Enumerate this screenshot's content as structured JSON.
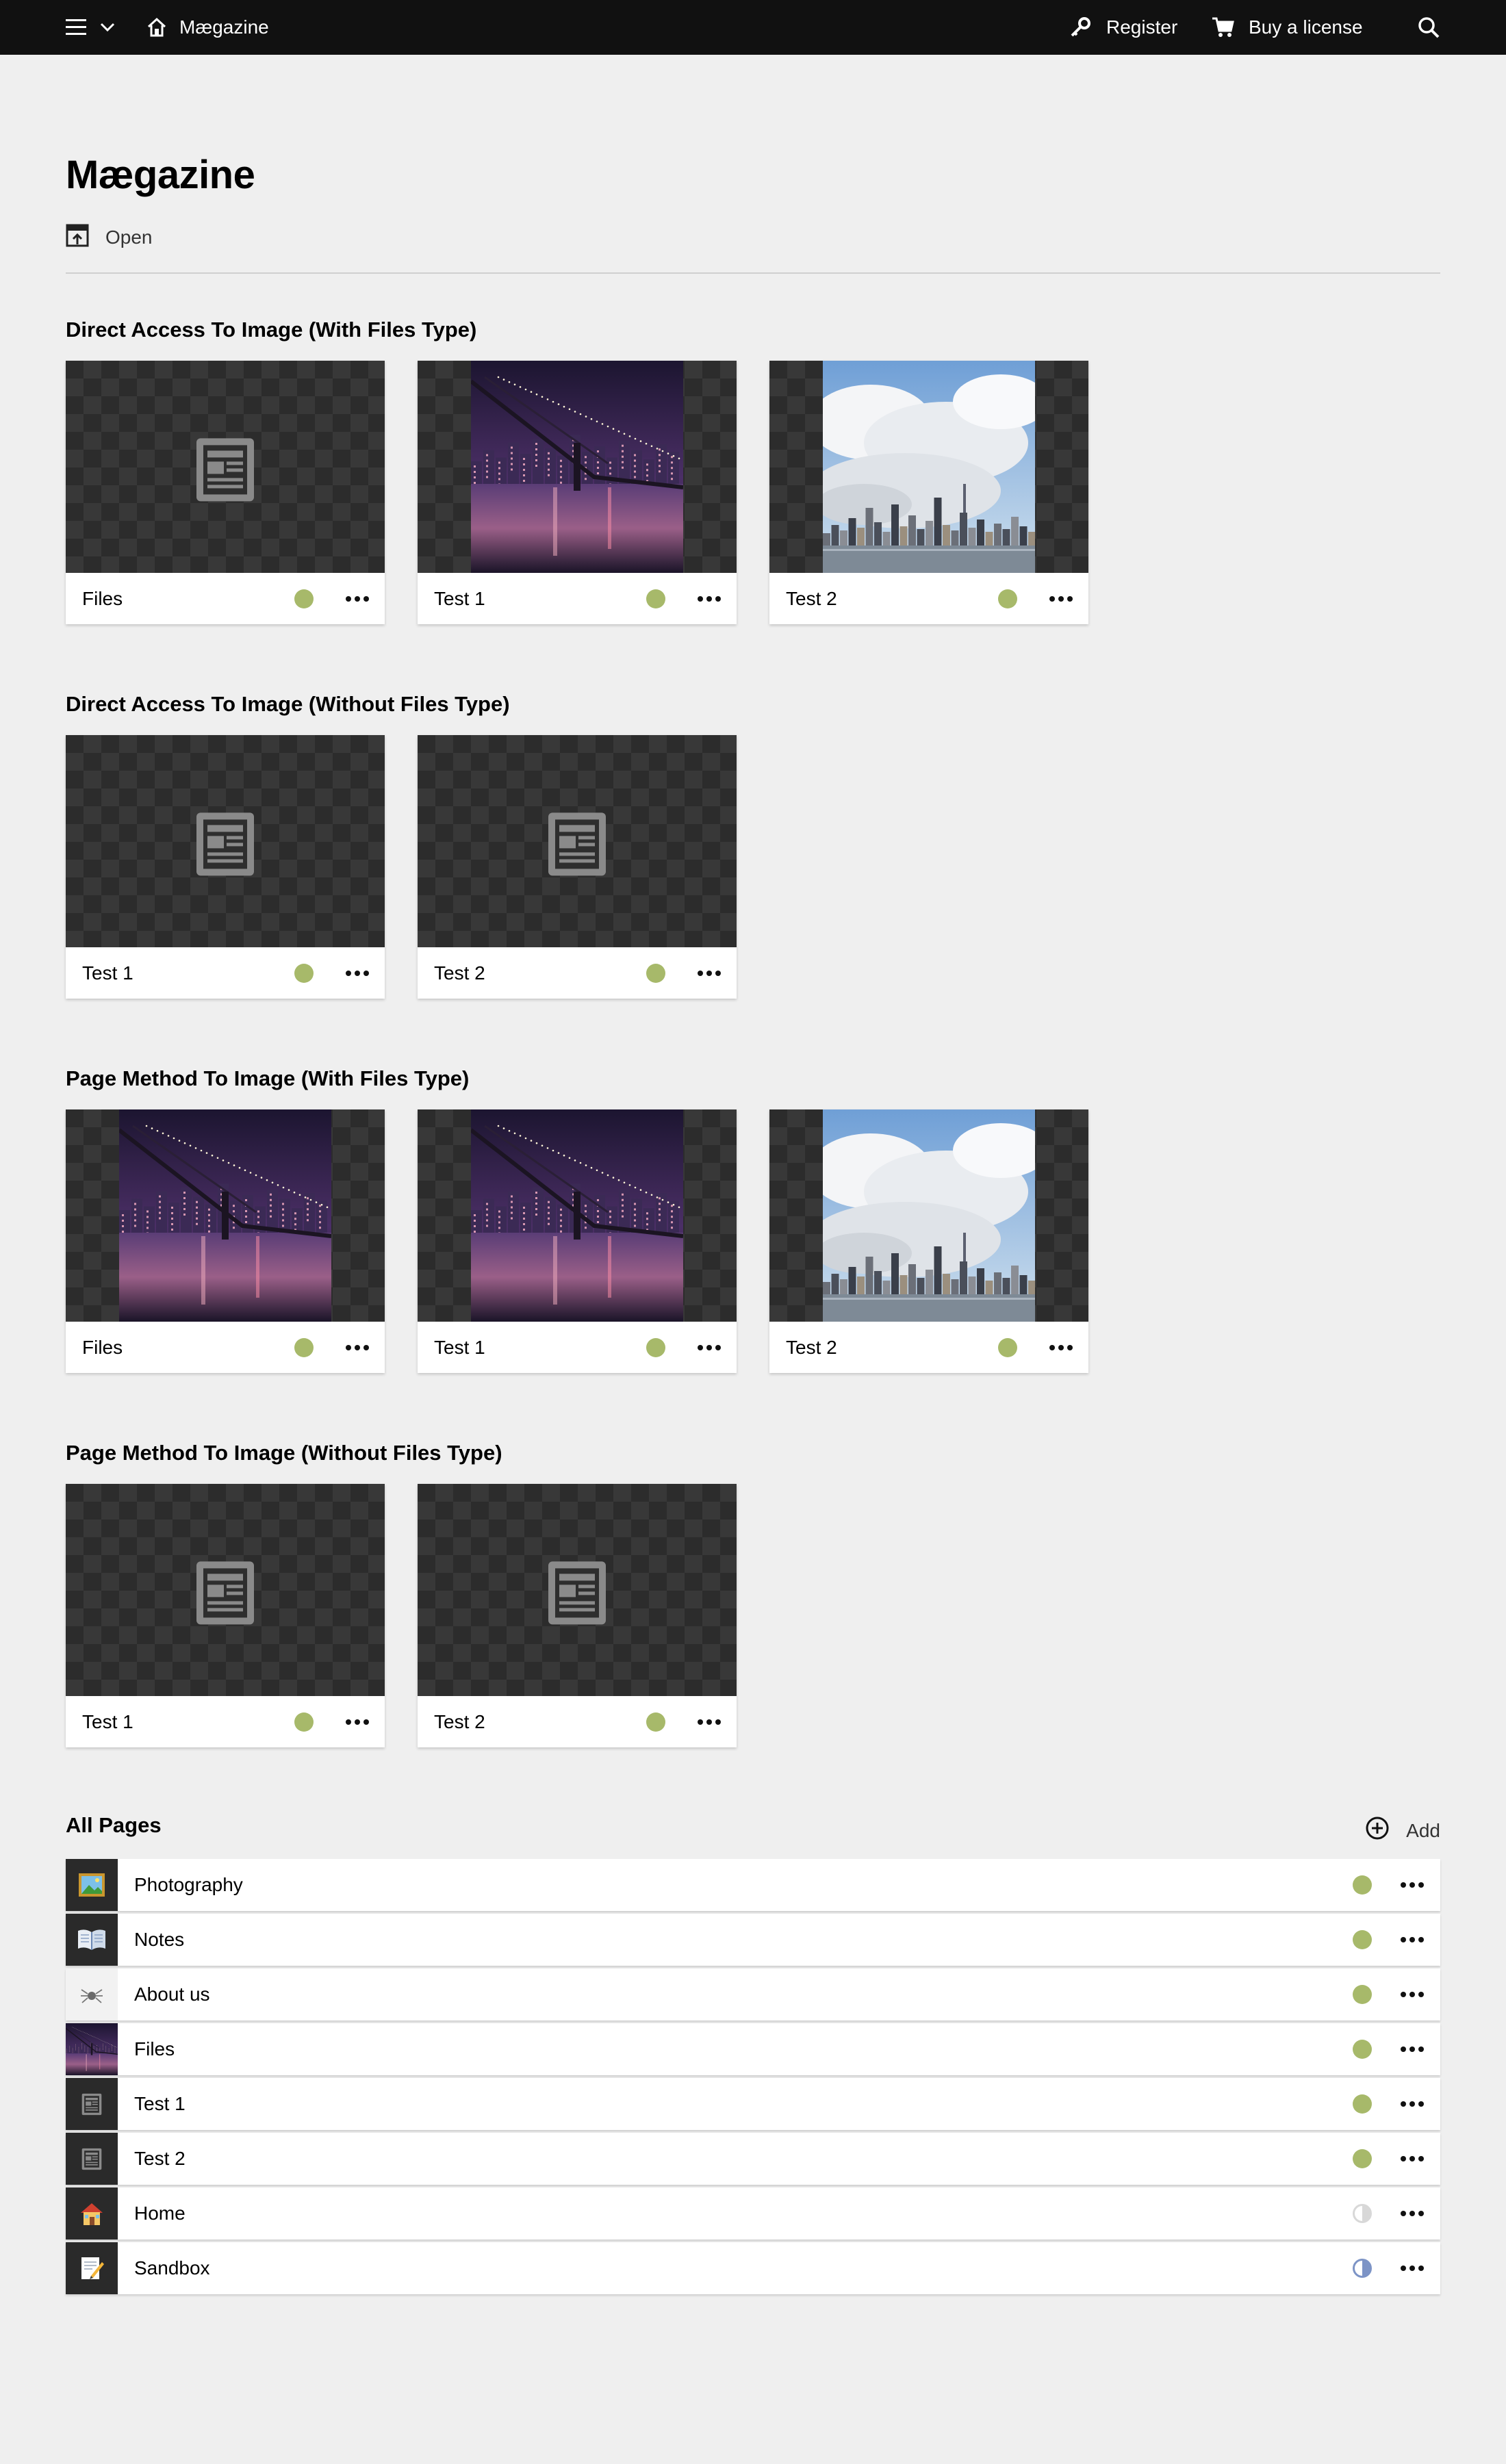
{
  "topbar": {
    "site_name": "Mægazine",
    "register_label": "Register",
    "buy_label": "Buy a license",
    "icons": [
      "menu-icon",
      "chevron-down-icon",
      "home-icon",
      "key-icon",
      "cart-icon",
      "search-icon"
    ]
  },
  "page": {
    "title": "Mægazine",
    "open_label": "Open"
  },
  "sections": [
    {
      "title": "Direct Access To Image (With Files Type)",
      "cards": [
        {
          "label": "Files",
          "thumb": "document-icon"
        },
        {
          "label": "Test 1",
          "thumb": "bridge-night-photo"
        },
        {
          "label": "Test 2",
          "thumb": "skyline-clouds-photo"
        }
      ]
    },
    {
      "title": "Direct Access To Image (Without Files Type)",
      "cards": [
        {
          "label": "Test 1",
          "thumb": "document-icon"
        },
        {
          "label": "Test 2",
          "thumb": "document-icon"
        }
      ]
    },
    {
      "title": "Page Method To Image (With Files Type)",
      "cards": [
        {
          "label": "Files",
          "thumb": "bridge-night-photo"
        },
        {
          "label": "Test 1",
          "thumb": "bridge-night-photo"
        },
        {
          "label": "Test 2",
          "thumb": "skyline-clouds-photo"
        }
      ]
    },
    {
      "title": "Page Method To Image (Without Files Type)",
      "cards": [
        {
          "label": "Test 1",
          "thumb": "document-icon"
        },
        {
          "label": "Test 2",
          "thumb": "document-icon"
        }
      ]
    }
  ],
  "all_pages": {
    "title": "All Pages",
    "add_label": "Add",
    "rows": [
      {
        "label": "Photography",
        "icon": "picture-frame-icon",
        "status": "listed"
      },
      {
        "label": "Notes",
        "icon": "open-book-icon",
        "status": "listed"
      },
      {
        "label": "About us",
        "icon": "spider-icon",
        "status": "listed"
      },
      {
        "label": "Files",
        "icon": "bridge-night-photo",
        "status": "listed"
      },
      {
        "label": "Test 1",
        "icon": "document-icon",
        "status": "listed"
      },
      {
        "label": "Test 2",
        "icon": "document-icon",
        "status": "listed"
      },
      {
        "label": "Home",
        "icon": "house-icon",
        "status": "draft"
      },
      {
        "label": "Sandbox",
        "icon": "memo-icon",
        "status": "unlisted"
      }
    ]
  },
  "colors": {
    "status_listed": "#a7b96a",
    "status_unlisted": "#7d94c6",
    "status_draft": "#d8d8d8",
    "topbar": "#111111",
    "background": "#efefef"
  }
}
